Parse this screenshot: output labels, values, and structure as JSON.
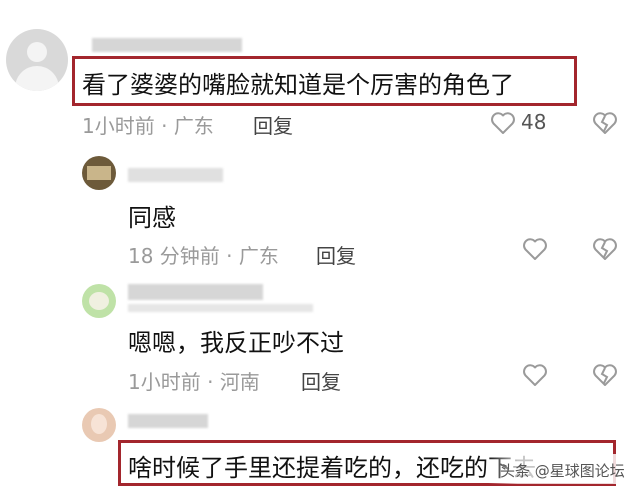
{
  "comments": [
    {
      "text": "看了婆婆的嘴脸就知道是个厉害的角色了",
      "time": "1小时前",
      "location": "广东",
      "reply": "回复",
      "likes": "48"
    },
    {
      "text": "同感",
      "time": "18 分钟前",
      "location": "广东",
      "reply": "回复"
    },
    {
      "text": "嗯嗯，我反正吵不过",
      "time": "1小时前",
      "location": "河南",
      "reply": "回复"
    },
    {
      "text": "啥时候了手里还提着吃的，还吃的下去"
    }
  ],
  "separator": "·",
  "watermark": "头条 @星球图论坛",
  "colors": {
    "highlight_border": "#a3262d",
    "meta_text": "#9a9a9a"
  },
  "icons": [
    "heart-icon",
    "broken-heart-icon",
    "avatar-icon"
  ]
}
